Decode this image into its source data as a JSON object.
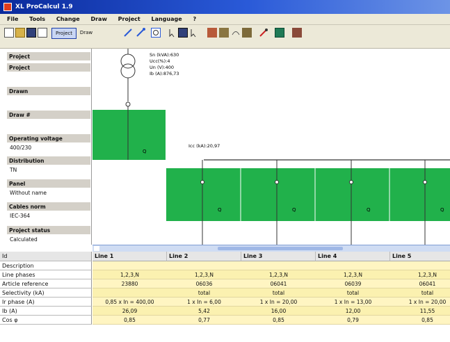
{
  "window": {
    "title": "XL ProCalcul 1.9"
  },
  "menu": [
    "File",
    "Tools",
    "Change",
    "Draw",
    "Project",
    "Language",
    "?"
  ],
  "toolbar": {
    "project_label": "Project",
    "draw_label": "Draw"
  },
  "project_panel": {
    "heading": "Project",
    "fields": [
      {
        "label": "Project",
        "value": ""
      },
      {
        "label": "Drawn",
        "value": ""
      },
      {
        "label": "Draw #",
        "value": ""
      },
      {
        "label": "Operating voltage",
        "value": "400/230"
      },
      {
        "label": "Distribution",
        "value": "TN"
      },
      {
        "label": "Panel",
        "value": "Without name"
      },
      {
        "label": "Cables norm",
        "value": "IEC-364"
      },
      {
        "label": "Project status",
        "value": "Calculated"
      }
    ]
  },
  "diagram": {
    "transformer_info": [
      "Sn (kVA):630",
      "Ucc(%):4",
      "Un (V):400",
      "Ib (A):876,73"
    ],
    "busbar_label": "Icc (kA):20,97",
    "colors": {
      "panel_fill": "#21b14b",
      "line": "#333333"
    }
  },
  "grid": {
    "row_labels": [
      "Id",
      "Description",
      "Line phases",
      "Article reference",
      "Selectivity (kA)",
      "Ir phase (A)",
      "Ib (A)",
      "Cos φ"
    ],
    "columns": [
      {
        "name": "Line 1",
        "values": [
          "",
          "1,2,3,N",
          "23880",
          "",
          "0,85 x In = 400,00",
          "26,09",
          "0,85"
        ]
      },
      {
        "name": "Line 2",
        "values": [
          "",
          "1,2,3,N",
          "06036",
          "total",
          "1 x In = 6,00",
          "5,42",
          "0,77"
        ]
      },
      {
        "name": "Line 3",
        "values": [
          "",
          "1,2,3,N",
          "06041",
          "total",
          "1 x In = 20,00",
          "16,00",
          "0,85"
        ]
      },
      {
        "name": "Line 4",
        "values": [
          "",
          "1,2,3,N",
          "06039",
          "total",
          "1 x In = 13,00",
          "12,00",
          "0,79"
        ]
      },
      {
        "name": "Line 5",
        "values": [
          "",
          "1,2,3,N",
          "06041",
          "total",
          "1 x In = 20,00",
          "11,55",
          "0,85"
        ]
      }
    ]
  }
}
